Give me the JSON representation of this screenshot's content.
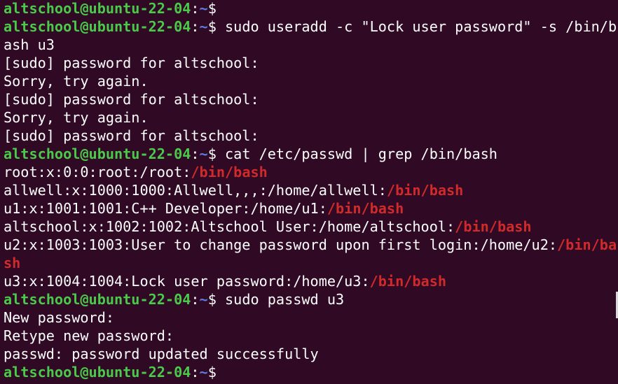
{
  "terminal": {
    "prompt": {
      "user_host": "altschool@ubuntu-22-04",
      "colon": ":",
      "path": "~",
      "dollar": "$"
    },
    "lines": [
      {
        "type": "prompt",
        "command": ""
      },
      {
        "type": "prompt",
        "command": " sudo useradd -c \"Lock user password\" -s /bin/b"
      },
      {
        "type": "output",
        "text": "ash u3"
      },
      {
        "type": "output",
        "text": "[sudo] password for altschool:"
      },
      {
        "type": "output",
        "text": "Sorry, try again."
      },
      {
        "type": "output",
        "text": "[sudo] password for altschool:"
      },
      {
        "type": "output",
        "text": "Sorry, try again."
      },
      {
        "type": "output",
        "text": "[sudo] password for altschool:"
      },
      {
        "type": "prompt",
        "command": " cat /etc/passwd | grep /bin/bash"
      },
      {
        "type": "grep",
        "text": "root:x:0:0:root:/root:",
        "match": "/bin/bash"
      },
      {
        "type": "grep",
        "text": "allwell:x:1000:1000:Allwell,,,:/home/allwell:",
        "match": "/bin/bash"
      },
      {
        "type": "grep",
        "text": "u1:x:1001:1001:C++ Developer:/home/u1:",
        "match": "/bin/bash"
      },
      {
        "type": "grep",
        "text": "altschool:x:1002:1002:Altschool User:/home/altschool:",
        "match": "/bin/bash"
      },
      {
        "type": "grep",
        "text": "u2:x:1003:1003:User to change password upon first login:/home/u2:",
        "match": "/bin/ba"
      },
      {
        "type": "grep",
        "text": "",
        "match": "sh"
      },
      {
        "type": "grep",
        "text": "u3:x:1004:1004:Lock user password:/home/u3:",
        "match": "/bin/bash"
      },
      {
        "type": "prompt",
        "command": " sudo passwd u3"
      },
      {
        "type": "output",
        "text": "New password:"
      },
      {
        "type": "output",
        "text": "Retype new password:"
      },
      {
        "type": "output",
        "text": "passwd: password updated successfully"
      },
      {
        "type": "prompt",
        "command": ""
      }
    ]
  },
  "colors": {
    "background": "#300a24",
    "prompt_user": "#4ac94a",
    "prompt_path": "#5c7be0",
    "text": "#ffffff",
    "grep_match": "#d02a2a"
  }
}
